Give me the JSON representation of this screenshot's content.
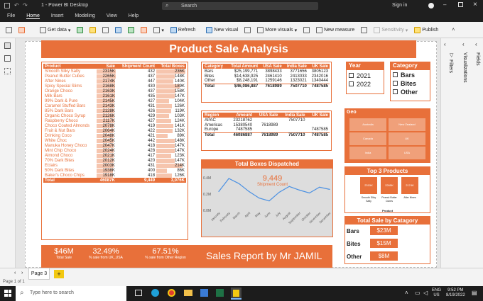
{
  "app": {
    "title": "1 - Power BI Desktop",
    "search_placeholder": "Search",
    "signin": "Sign in"
  },
  "menu": [
    "File",
    "Home",
    "Insert",
    "Modeling",
    "View",
    "Help"
  ],
  "ribbon": {
    "get_data": "Get data",
    "refresh": "Refresh",
    "new_visual": "New visual",
    "more_visuals": "More visuals",
    "new_measure": "New measure",
    "sensitivity": "Sensitivity",
    "publish": "Publish"
  },
  "report": {
    "title": "Product Sale Analysis",
    "footer_text": "Sales Report by Mr JAMIL"
  },
  "product_table": {
    "headers": [
      "Product",
      "Sale",
      "Shipment Count",
      "Total Boxes"
    ],
    "rows": [
      [
        "Smooth Sliky Salty",
        "2315K",
        "432",
        "236K",
        0.98,
        0.97
      ],
      [
        "Peanut Butter Cubes",
        "2265K",
        "437",
        "148K",
        0.96,
        0.61
      ],
      [
        "After Nines",
        "2174K",
        "447",
        "140K",
        0.92,
        0.58
      ],
      [
        "Spicy Special Slims",
        "2168K",
        "430",
        "189K",
        0.92,
        0.78
      ],
      [
        "Orange Choco",
        "2163K",
        "437",
        "158K",
        0.92,
        0.65
      ],
      [
        "Milk Bars",
        "2161K",
        "435",
        "147K",
        0.92,
        0.61
      ],
      [
        "99% Dark & Pure",
        "2145K",
        "427",
        "104K",
        0.91,
        0.43
      ],
      [
        "Caramel Stuffed Bars",
        "2143K",
        "431",
        "126K",
        0.91,
        0.52
      ],
      [
        "85% Dark Bars",
        "2128K",
        "426",
        "119K",
        0.9,
        0.49
      ],
      [
        "Organic Choco Syrup",
        "2126K",
        "429",
        "103K",
        0.9,
        0.42
      ],
      [
        "Raspberry Choco",
        "2117K",
        "427",
        "124K",
        0.9,
        0.51
      ],
      [
        "Choco Coated Almonds",
        "2078K",
        "419",
        "141K",
        0.88,
        0.58
      ],
      [
        "Fruit & Nut Bars",
        "2064K",
        "422",
        "132K",
        0.88,
        0.54
      ],
      [
        "Drinking Coco",
        "2048K",
        "421",
        "89K",
        0.87,
        0.37
      ],
      [
        "White Choc",
        "2045K",
        "442",
        "148K",
        0.87,
        0.61
      ],
      [
        "Manuka Honey Choco",
        "2047K",
        "418",
        "147K",
        0.87,
        0.61
      ],
      [
        "Mint Chip Choco",
        "2024K",
        "428",
        "147K",
        0.86,
        0.61
      ],
      [
        "Almond Choco",
        "2021K",
        "417",
        "123K",
        0.86,
        0.51
      ],
      [
        "70% Dark Bites",
        "2012K",
        "420",
        "147K",
        0.85,
        0.61
      ],
      [
        "Eclairs",
        "2003K",
        "431",
        "214K",
        0.85,
        0.88
      ],
      [
        "50% Dark Bites",
        "1938K",
        "400",
        "86K",
        0.82,
        0.35
      ],
      [
        "Baker's Choco Chips",
        "1918K",
        "418",
        "126K",
        0.81,
        0.52
      ]
    ],
    "total": [
      "Total",
      "46087K",
      "9,449",
      "3,076K"
    ]
  },
  "category_table": {
    "headers": [
      "Category",
      "Total Amount",
      "USA Sale",
      "India Sale",
      "UK Sale"
    ],
    "rows": [
      [
        "Bars",
        "$25,199,771",
        "3898433",
        "3771656",
        "3805123"
      ],
      [
        "Bites",
        "$14,638,925",
        "2461410",
        "2413033",
        "2342016"
      ],
      [
        "Other",
        "$8,248,191",
        "1259146",
        "1323021",
        "1340444"
      ]
    ],
    "total": [
      "Total",
      "$46,086,887",
      "7618989",
      "7507710",
      "7487585"
    ]
  },
  "region_table": {
    "headers": [
      "Region",
      "Amount",
      "USA Sale",
      "India Sale",
      "UK Sale"
    ],
    "rows": [
      [
        "APAC",
        "23218762",
        "",
        "7507710",
        ""
      ],
      [
        "Americas",
        "15380540",
        "7618989",
        "",
        ""
      ],
      [
        "Europe",
        "7487585",
        "",
        "",
        "7487585"
      ]
    ],
    "total": [
      "Total",
      "46086887",
      "7618989",
      "7507710",
      "7487585"
    ]
  },
  "year_slicer": {
    "title": "Year",
    "options": [
      "2021",
      "2022"
    ]
  },
  "category_slicer": {
    "title": "Category",
    "options": [
      "Bars",
      "Bites",
      "Other"
    ]
  },
  "geo": {
    "title": "Geo",
    "tiles": [
      "Australia",
      "New Zealand",
      "Canada",
      "UK",
      "India",
      "USA"
    ]
  },
  "line_chart": {
    "title": "Total Boxes Dispatched",
    "kpi_value": "9,449",
    "kpi_label": "Shipment Count",
    "y_ticks": [
      "0.4M",
      "0.2M",
      "0.0M"
    ]
  },
  "chart_data": {
    "type": "line",
    "title": "Total Boxes Dispatched",
    "categories": [
      "January",
      "February",
      "March",
      "April",
      "May",
      "June",
      "July",
      "August",
      "September",
      "October",
      "November",
      "December"
    ],
    "values": [
      0.26,
      0.44,
      0.37,
      0.26,
      0.17,
      0.13,
      0.25,
      0.33,
      0.28,
      0.24,
      0.32,
      0.29
    ],
    "ylim": [
      0,
      0.45
    ],
    "y_unit": "M"
  },
  "top3": {
    "title": "Top 3 Products",
    "items": [
      {
        "value": "2315K",
        "label": "Smooth Sliky Salty"
      },
      {
        "value": "2265K",
        "label": "Peanut Butter Cubes"
      },
      {
        "value": "2174K",
        "label": "After Nines"
      }
    ],
    "axis_label": "Product"
  },
  "cat_sales": {
    "title": "Total Sale by Catagory",
    "rows": [
      {
        "label": "Bars",
        "value": "$23M"
      },
      {
        "label": "Bites",
        "value": "$15M"
      },
      {
        "label": "Other",
        "value": "$8M"
      }
    ]
  },
  "kpis": [
    {
      "value": "$46M",
      "label": "Total Sale"
    },
    {
      "value": "32.49%",
      "label": "% sale from UK_USA"
    },
    {
      "value": "67.51%",
      "label": "% sale from Other Region"
    }
  ],
  "panes": {
    "filters": "Filters",
    "visualizations": "Visualizations",
    "fields": "Fields"
  },
  "pages": {
    "page": "Page 3",
    "add": "+",
    "status": "Page 1 of 1"
  },
  "taskbar": {
    "search_placeholder": "Type here to search",
    "lang1": "ENG",
    "lang2": "US",
    "time": "9:52 PM",
    "date": "8/19/2022"
  },
  "colors": {
    "accent": "#e8703a",
    "bar_light": "#f6c5ae",
    "line": "#4a90e2"
  }
}
